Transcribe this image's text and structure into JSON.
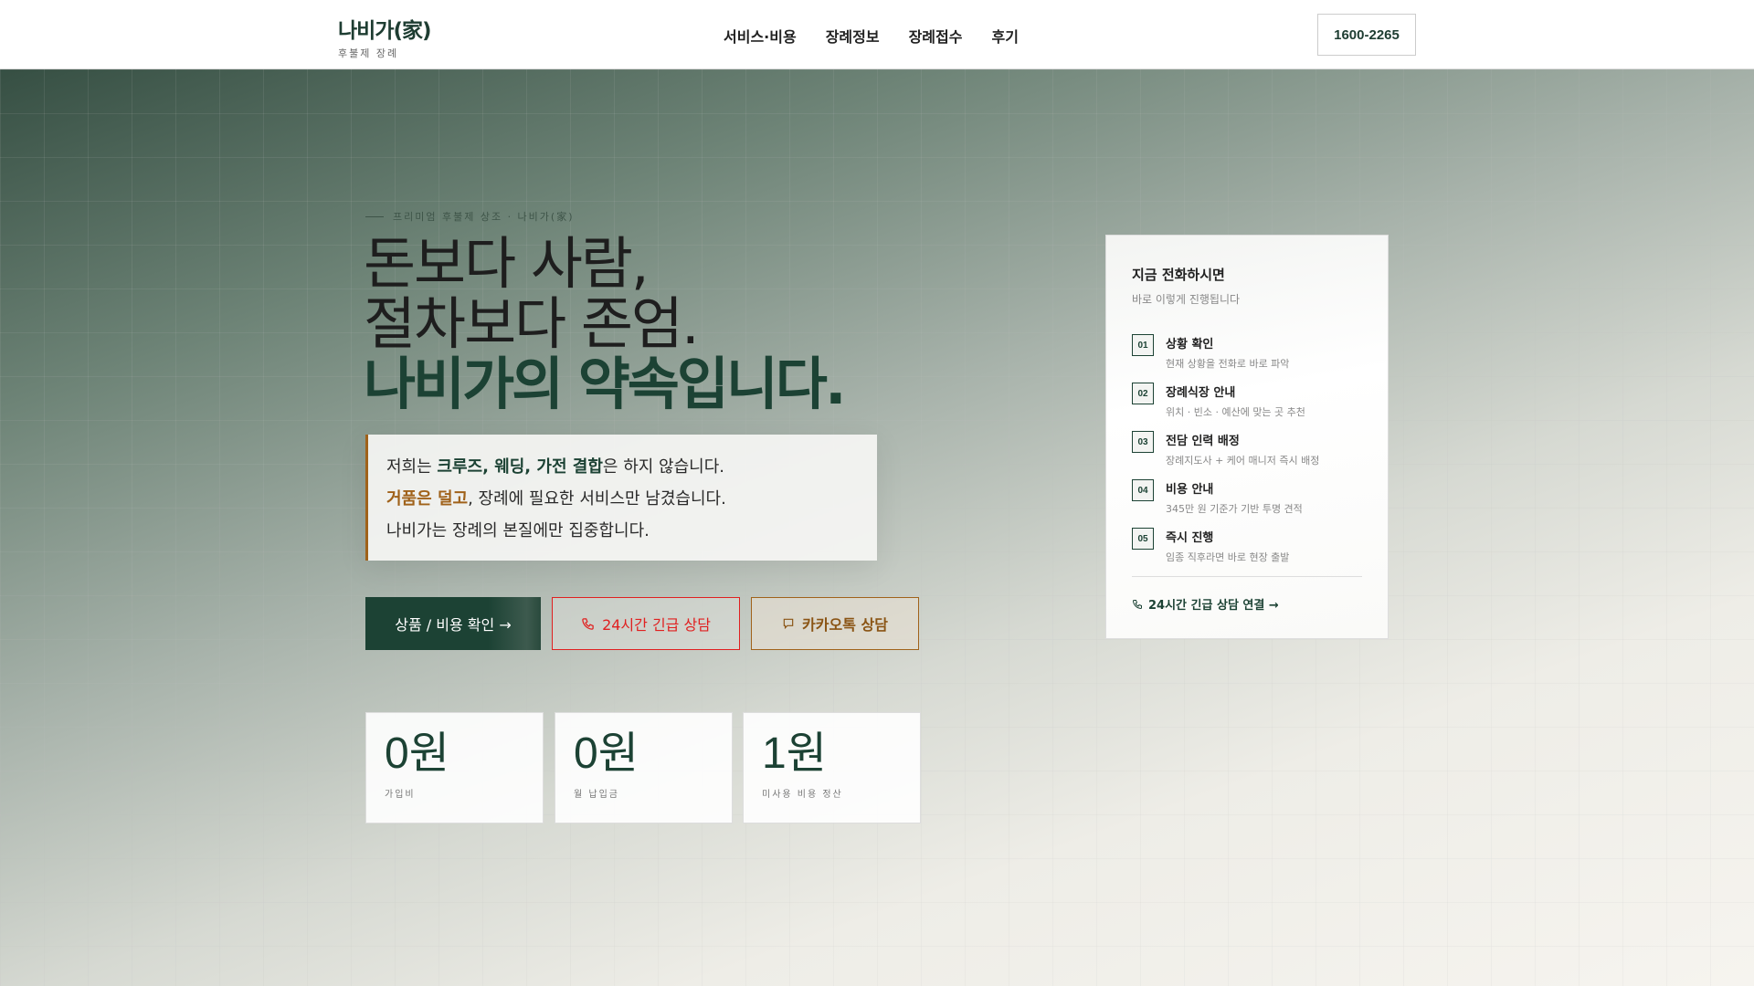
{
  "header": {
    "logo_title": "나비가(家)",
    "logo_sub": "후불제 장례",
    "nav": [
      "서비스·비용",
      "장례정보",
      "장례접수",
      "후기"
    ],
    "phone": "1600-2265"
  },
  "hero": {
    "eyebrow": "프리미엄 후불제 상조 · 나비가(家)",
    "line1": "돈보다 사람,",
    "line2": "절차보다 존엄.",
    "line3": "나비가의 약속입니다.",
    "quote": {
      "l1a": "저희는 ",
      "l1b": "크루즈, 웨딩, 가전 결합",
      "l1c": "은 하지 않습니다.",
      "l2a": "거품은 덜고",
      "l2b": ", 장례에 필요한 서비스만 남겼습니다.",
      "l3": "나비가는 장례의 본질에만 집중합니다."
    },
    "buttons": {
      "products": "상품 / 비용 확인 →",
      "emergency": "24시간 긴급 상담",
      "kakao": "카카오톡 상담"
    },
    "stats": [
      {
        "value": "0원",
        "label": "가입비"
      },
      {
        "value": "0원",
        "label": "월 납입금"
      },
      {
        "value": "1원",
        "label": "미사용 비용 정산"
      }
    ]
  },
  "card": {
    "title": "지금 전화하시면",
    "subtitle": "바로 이렇게 진행됩니다",
    "steps": [
      {
        "num": "01",
        "title": "상황 확인",
        "desc": "현재 상황을 전화로 바로 파악"
      },
      {
        "num": "02",
        "title": "장례식장 안내",
        "desc": "위치 · 빈소 · 예산에 맞는 곳 추천"
      },
      {
        "num": "03",
        "title": "전담 인력 배정",
        "desc": "장례지도사 + 케어 매니저 즉시 배정"
      },
      {
        "num": "04",
        "title": "비용 안내",
        "desc": "345만 원 기준가 기반 투명 견적"
      },
      {
        "num": "05",
        "title": "즉시 진행",
        "desc": "임종 직후라면 바로 현장 출발"
      }
    ],
    "call": "24시간 긴급 상담 연결 →"
  },
  "colors": {
    "brand": "#1c4234",
    "accent": "#a0621a",
    "emergency": "#e02020"
  }
}
